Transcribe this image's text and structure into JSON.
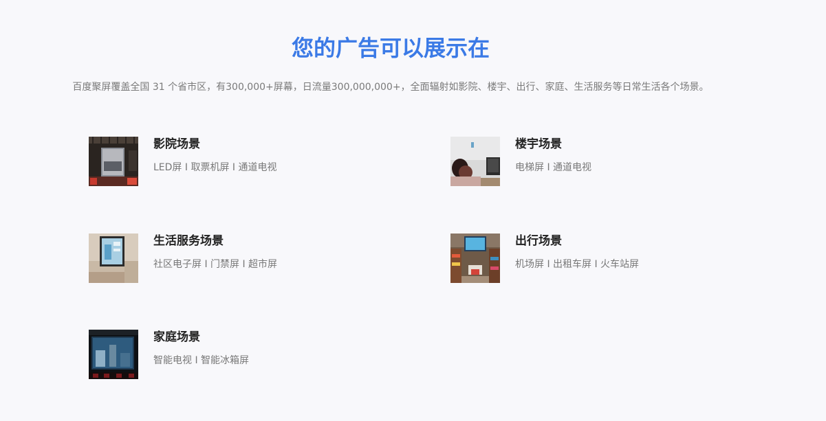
{
  "header": {
    "title": "您的广告可以展示在",
    "subtitle": "百度聚屏覆盖全国 31 个省市区，有300,000+屏幕，日流量300,000,000+，全面辐射如影院、楼宇、出行、家庭、生活服务等日常生活各个场景。"
  },
  "scenes": [
    {
      "title": "影院场景",
      "desc": "LED屏 I 取票机屏 I 通道电视"
    },
    {
      "title": "楼宇场景",
      "desc": "电梯屏 I 通道电视"
    },
    {
      "title": "生活服务场景",
      "desc": "社区电子屏 I 门禁屏 I 超市屏"
    },
    {
      "title": "出行场景",
      "desc": "机场屏 I 出租车屏 I 火车站屏"
    },
    {
      "title": "家庭场景",
      "desc": "智能电视 I 智能冰箱屏"
    }
  ],
  "colors": {
    "title": "#3b7ae6",
    "background": "#f8f8fb",
    "heading": "#222222",
    "body_text": "#777777"
  }
}
